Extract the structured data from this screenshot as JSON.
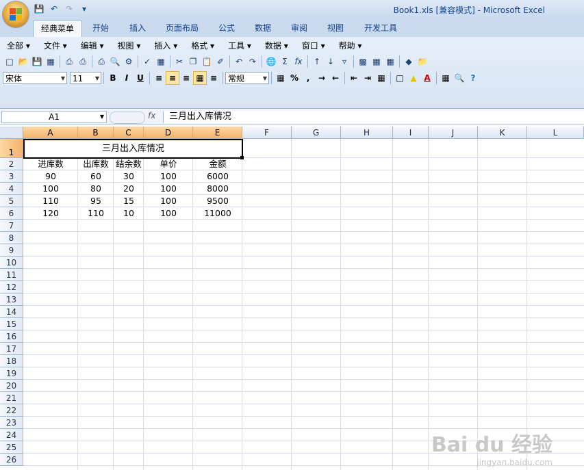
{
  "window": {
    "title": "Book1.xls  [兼容模式] - Microsoft Excel"
  },
  "tabs": [
    "经典菜单",
    "开始",
    "插入",
    "页面布局",
    "公式",
    "数据",
    "审阅",
    "视图",
    "开发工具"
  ],
  "active_tab": "经典菜单",
  "menubar": [
    "全部 ▾",
    "文件 ▾",
    "编辑 ▾",
    "视图 ▾",
    "插入 ▾",
    "格式 ▾",
    "工具 ▾",
    "数据 ▾",
    "窗口 ▾",
    "帮助 ▾"
  ],
  "toolbar": {
    "font_name": "宋体",
    "font_size": "11",
    "number_format": "常规",
    "bold": "B",
    "italic": "I",
    "underline": "U",
    "sum": "Σ",
    "fx": "fx",
    "percent": "%",
    "comma": ","
  },
  "formula_bar": {
    "name_box": "A1",
    "fx_label": "fx",
    "content": "三月出入库情况"
  },
  "columns": [
    "A",
    "B",
    "C",
    "D",
    "E",
    "F",
    "G",
    "H",
    "I",
    "J",
    "K",
    "L"
  ],
  "rows": [
    "1",
    "2",
    "3",
    "4",
    "5",
    "6",
    "7",
    "8",
    "9",
    "10",
    "11",
    "12",
    "13",
    "14",
    "15",
    "16",
    "17",
    "18",
    "19",
    "20",
    "21",
    "22",
    "23",
    "24",
    "25",
    "26"
  ],
  "sheet": {
    "title": "三月出入库情况",
    "headers": [
      "进库数",
      "出库数",
      "结余数",
      "单价",
      "金额"
    ],
    "data": [
      [
        "90",
        "60",
        "30",
        "100",
        "6000"
      ],
      [
        "100",
        "80",
        "20",
        "100",
        "8000"
      ],
      [
        "110",
        "95",
        "15",
        "100",
        "9500"
      ],
      [
        "120",
        "110",
        "10",
        "100",
        "11000"
      ]
    ]
  },
  "watermark": {
    "text": "Bai du 经验",
    "sub": "jingyan.baidu.com"
  },
  "colors": {
    "accent": "#15428b",
    "selected_header": "#f6b16a"
  }
}
